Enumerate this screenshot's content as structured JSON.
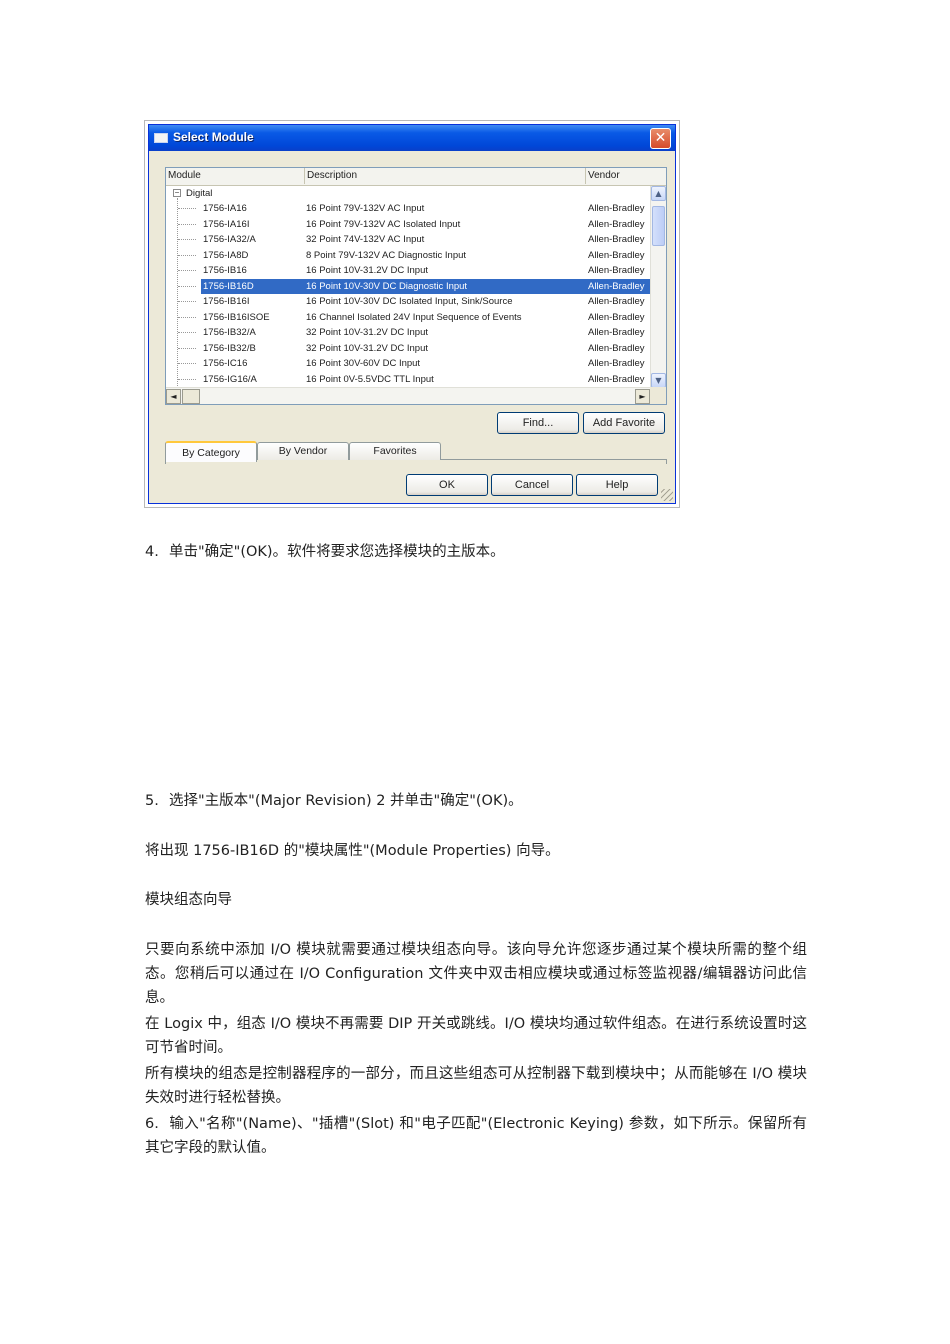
{
  "dialog": {
    "title": "Select Module",
    "close_glyph": "✕",
    "columns": {
      "module": "Module",
      "description": "Description",
      "vendor": "Vendor"
    },
    "group": {
      "expander": "−",
      "label": "Digital"
    },
    "modules": [
      {
        "module": "1756-IA16",
        "description": "16 Point 79V-132V AC Input",
        "vendor": "Allen-Bradley",
        "selected": false
      },
      {
        "module": "1756-IA16I",
        "description": "16 Point 79V-132V AC Isolated Input",
        "vendor": "Allen-Bradley",
        "selected": false
      },
      {
        "module": "1756-IA32/A",
        "description": "32 Point 74V-132V AC Input",
        "vendor": "Allen-Bradley",
        "selected": false
      },
      {
        "module": "1756-IA8D",
        "description": "8 Point 79V-132V AC Diagnostic Input",
        "vendor": "Allen-Bradley",
        "selected": false
      },
      {
        "module": "1756-IB16",
        "description": "16 Point 10V-31.2V DC Input",
        "vendor": "Allen-Bradley",
        "selected": false
      },
      {
        "module": "1756-IB16D",
        "description": "16 Point 10V-30V DC Diagnostic Input",
        "vendor": "Allen-Bradley",
        "selected": true
      },
      {
        "module": "1756-IB16I",
        "description": "16 Point 10V-30V DC Isolated Input, Sink/Source",
        "vendor": "Allen-Bradley",
        "selected": false
      },
      {
        "module": "1756-IB16ISOE",
        "description": "16 Channel Isolated 24V Input Sequence of Events",
        "vendor": "Allen-Bradley",
        "selected": false
      },
      {
        "module": "1756-IB32/A",
        "description": "32 Point 10V-31.2V DC Input",
        "vendor": "Allen-Bradley",
        "selected": false
      },
      {
        "module": "1756-IB32/B",
        "description": "32 Point 10V-31.2V DC Input",
        "vendor": "Allen-Bradley",
        "selected": false
      },
      {
        "module": "1756-IC16",
        "description": "16 Point 30V-60V DC Input",
        "vendor": "Allen-Bradley",
        "selected": false
      },
      {
        "module": "1756-IG16/A",
        "description": "16 Point 0V-5.5VDC TTL Input",
        "vendor": "Allen-Bradley",
        "selected": false
      }
    ],
    "scroll_up_glyph": "▲",
    "scroll_down_glyph": "▼",
    "scroll_left_glyph": "◄",
    "scroll_right_glyph": "►",
    "find_button": "Find...",
    "add_favorite_button": "Add Favorite",
    "tabs": [
      "By Category",
      "By Vendor",
      "Favorites"
    ],
    "active_tab": 0,
    "ok_button": "OK",
    "cancel_button": "Cancel",
    "help_button": "Help"
  },
  "doc": {
    "step4": {
      "num": "4.",
      "text": "单击\"确定\"(OK)。软件将要求您选择模块的主版本。"
    },
    "step5": {
      "num": "5.",
      "text": "选择\"主版本\"(Major Revision) 2 并单击\"确定\"(OK)。"
    },
    "p_wizard_appears": "将出现 1756-IB16D 的\"模块属性\"(Module Properties) 向导。",
    "heading": "模块组态向导",
    "p1": "只要向系统中添加 I/O 模块就需要通过模块组态向导。该向导允许您逐步通过某个模块所需的整个组态。您稍后可以通过在 I/O Configuration 文件夹中双击相应模块或通过标签监视器/编辑器访问此信息。",
    "p2": "在 Logix 中，组态 I/O 模块不再需要 DIP 开关或跳线。I/O 模块均通过软件组态。在进行系统设置时这可节省时间。",
    "p3": "所有模块的组态是控制器程序的一部分，而且这些组态可从控制器下载到模块中；从而能够在 I/O 模块失效时进行轻松替换。",
    "step6": {
      "num": "6.",
      "text": "输入\"名称\"(Name)、\"插槽\"(Slot) 和\"电子匹配\"(Electronic Keying) 参数，如下所示。保留所有其它字段的默认值。"
    }
  }
}
